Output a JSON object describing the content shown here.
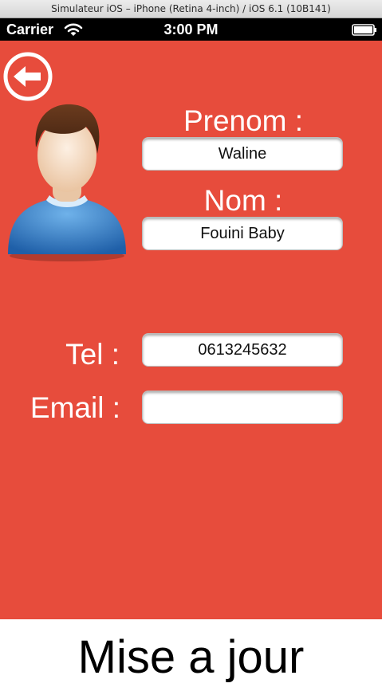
{
  "window": {
    "title": "Simulateur iOS – iPhone (Retina 4-inch) / iOS 6.1 (10B141)"
  },
  "status_bar": {
    "carrier": "Carrier",
    "time": "3:00 PM",
    "wifi_icon": "wifi-icon",
    "battery_icon": "battery-icon"
  },
  "colors": {
    "background": "#e74c3c",
    "status_bar": "#000000",
    "text": "#ffffff",
    "button_bg": "#ffffff"
  },
  "header": {
    "back_icon": "back-arrow-icon"
  },
  "avatar": {
    "icon": "user-avatar-icon"
  },
  "form": {
    "prenom_label": "Prenom :",
    "prenom_value": "Waline",
    "nom_label": "Nom :",
    "nom_value": "Fouini Baby",
    "tel_label": "Tel :",
    "tel_value": "0613245632",
    "email_label": "Email :",
    "email_value": ""
  },
  "footer": {
    "update_label": "Mise a jour"
  }
}
